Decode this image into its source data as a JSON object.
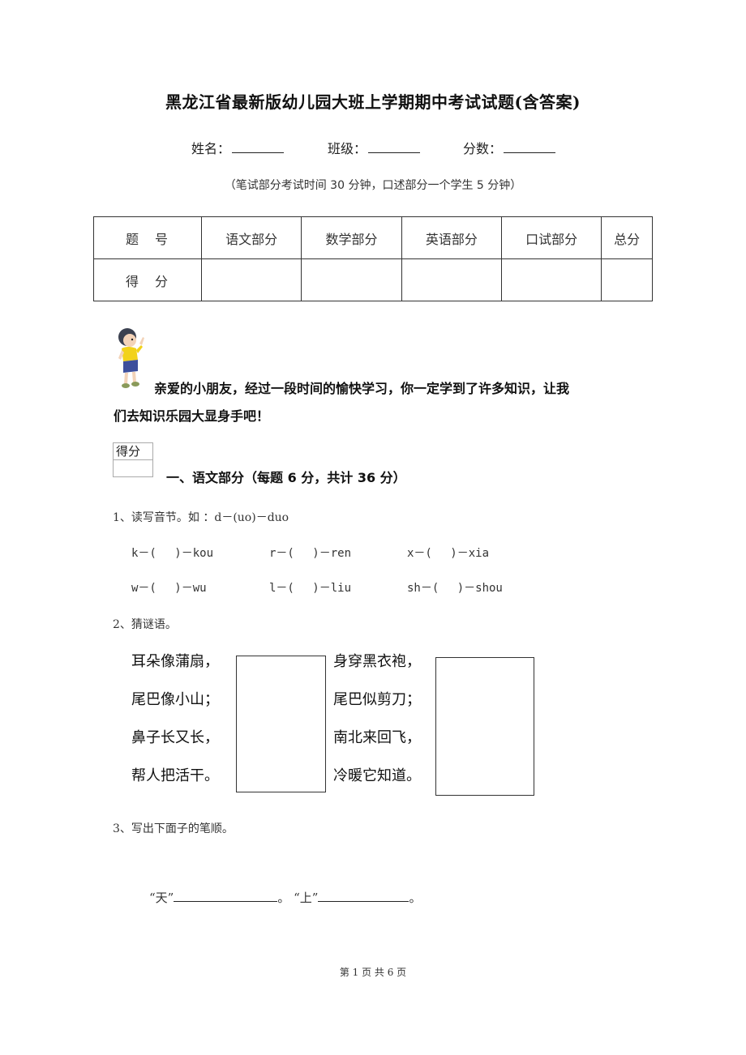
{
  "title": "黑龙江省最新版幼儿园大班上学期期中考试试题(含答案)",
  "info_fields": [
    {
      "label": "姓名："
    },
    {
      "label": "班级："
    },
    {
      "label": "分数："
    }
  ],
  "note": "（笔试部分考试时间 30 分钟，口述部分一个学生 5 分钟）",
  "score_table": {
    "header_label": "题号",
    "columns": [
      "语文部分",
      "数学部分",
      "英语部分",
      "口试部分",
      "总分"
    ],
    "row_label": "得分",
    "values": [
      "",
      "",
      "",
      "",
      ""
    ]
  },
  "intro": {
    "line1": "亲爱的小朋友，经过一段时间的愉快学习，你一定学到了许多知识，让我",
    "line2": "们去知识乐园大显身手吧！",
    "image": "boy-pointing-illustration"
  },
  "score_box_label": "得分",
  "section1": {
    "title": "一、语文部分（每题 6 分，共计 36 分）",
    "q1": {
      "prompt": "1、读写音节。如 ：d－(uo)－duo",
      "items": [
        "k－(　 )－kou",
        "r－(　 )－ren",
        "x－(　 )－xia",
        "w－(　 )－wu",
        "l－(　 )－liu",
        "sh－(　 )－shou"
      ]
    },
    "q2": {
      "prompt": "2、猜谜语。",
      "riddle_a": [
        "耳朵像蒲扇，",
        "尾巴像小山；",
        "鼻子长又长，",
        "帮人把活干。"
      ],
      "riddle_b": [
        "身穿黑衣袍，",
        "尾巴似剪刀；",
        "南北来回飞，",
        "冷暖它知道。"
      ]
    },
    "q3": {
      "prompt": "3、写出下面子的笔顺。",
      "char1": "“天”",
      "char2": "“上”",
      "end": "。"
    }
  },
  "footer": "第 1 页 共 6 页"
}
